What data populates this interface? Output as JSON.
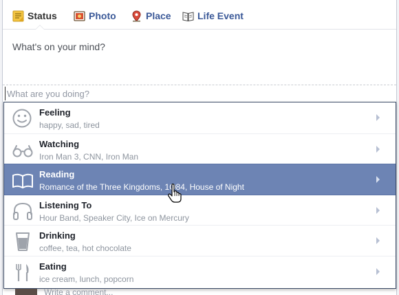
{
  "tabs": [
    {
      "label": "Status",
      "icon": "status-icon"
    },
    {
      "label": "Photo",
      "icon": "photo-icon"
    },
    {
      "label": "Place",
      "icon": "place-pin-icon"
    },
    {
      "label": "Life Event",
      "icon": "life-event-book-icon"
    }
  ],
  "composer": {
    "prompt": "What's on your mind?",
    "activity_placeholder": "What are you doing?"
  },
  "menu": {
    "highlighted_index": 2,
    "items": [
      {
        "label": "Feeling",
        "examples": "happy, sad, tired",
        "icon": "smiley-face-icon"
      },
      {
        "label": "Watching",
        "examples": "Iron Man 3, CNN, Iron Man",
        "icon": "glasses-icon"
      },
      {
        "label": "Reading",
        "examples": "Romance of the Three Kingdoms, 1Q84, House of Night",
        "icon": "open-book-icon"
      },
      {
        "label": "Listening To",
        "examples": "Hour Band, Speaker City, Ice on Mercury",
        "icon": "headphones-icon"
      },
      {
        "label": "Drinking",
        "examples": "coffee, tea, hot chocolate",
        "icon": "cup-icon"
      },
      {
        "label": "Eating",
        "examples": "ice cream, lunch, popcorn",
        "icon": "fork-knife-icon"
      }
    ]
  },
  "footer": {
    "comment_placeholder": "Write a comment..."
  },
  "colors": {
    "link": "#3b5998",
    "highlight": "#6d84b4",
    "menu_border": "#3b4a66"
  }
}
